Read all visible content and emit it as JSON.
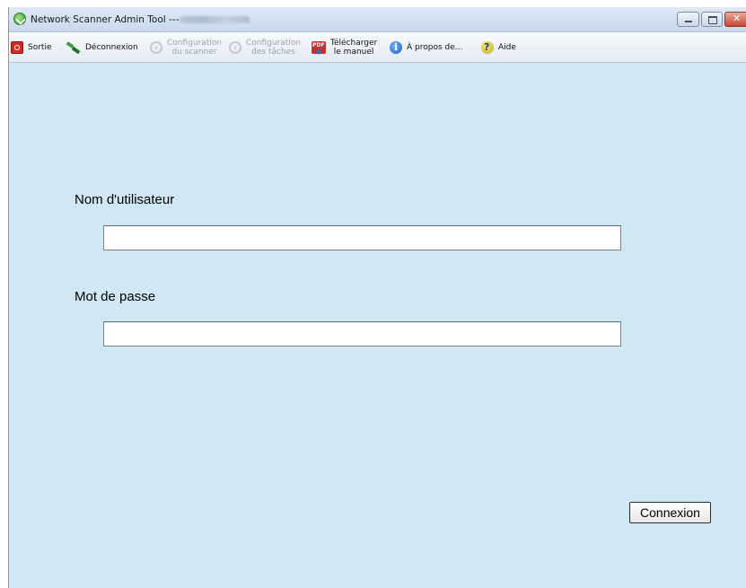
{
  "window": {
    "title": "Network Scanner Admin Tool  ---"
  },
  "toolbar": {
    "items": [
      {
        "label": "Sortie",
        "icon": "exit-icon",
        "enabled": true
      },
      {
        "label": "Déconnexion",
        "icon": "disconnect-icon",
        "enabled": true
      },
      {
        "label_line1": "Configuration",
        "label_line2": "du scanner",
        "icon": "gear-icon",
        "enabled": false
      },
      {
        "label_line1": "Configuration",
        "label_line2": "des tâches",
        "icon": "gear-icon",
        "enabled": false
      },
      {
        "label_line1": "Télécharger",
        "label_line2": "le manuel",
        "icon": "pdf-icon",
        "enabled": true
      },
      {
        "label": "À propos de...",
        "icon": "info-icon",
        "enabled": true
      },
      {
        "label": "Aide",
        "icon": "help-icon",
        "enabled": true
      }
    ]
  },
  "login": {
    "username_label": "Nom d'utilisateur",
    "username_value": "",
    "password_label": "Mot de passe",
    "password_value": "",
    "submit_label": "Connexion"
  }
}
